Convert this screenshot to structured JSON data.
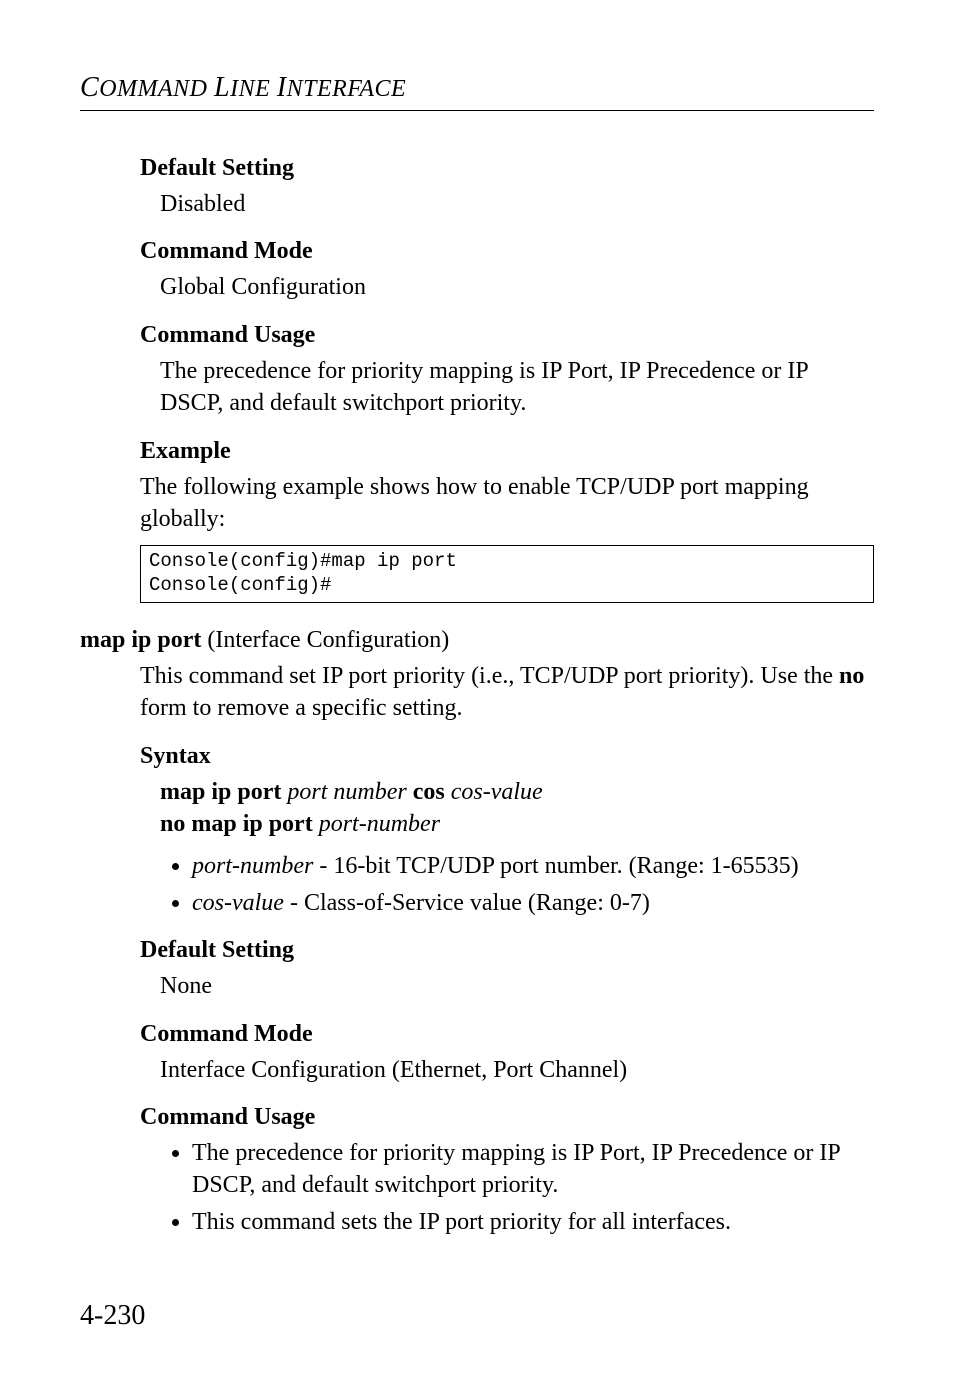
{
  "header": {
    "running_head_1": "C",
    "running_head_2": "OMMAND ",
    "running_head_3": "L",
    "running_head_4": "INE ",
    "running_head_5": "I",
    "running_head_6": "NTERFACE"
  },
  "sec1": {
    "default_h": "Default Setting",
    "default_v": "Disabled",
    "mode_h": "Command Mode",
    "mode_v": "Global Configuration",
    "usage_h": "Command Usage",
    "usage_v": "The precedence for priority mapping is IP Port, IP Precedence or IP DSCP, and default switchport priority.",
    "example_h": "Example",
    "example_intro": "The following example shows how to enable TCP/UDP port mapping globally:",
    "code": "Console(config)#map ip port\nConsole(config)#"
  },
  "cmd": {
    "title_bold": "map ip port",
    "title_rest": " (Interface Configuration)",
    "desc_p1": "This command set IP port priority (i.e., TCP/UDP port priority). Use the ",
    "desc_bold": "no",
    "desc_p2": " form to remove a specific setting.",
    "syntax_h": "Syntax",
    "syntax_l1_b1": "map ip port",
    "syntax_l1_i1": " port number ",
    "syntax_l1_b2": "cos",
    "syntax_l1_i2": " cos-value",
    "syntax_l2_b": "no map ip port",
    "syntax_l2_i": " port-number",
    "param1_i": "port-number",
    "param1_rest": " - 16-bit TCP/UDP port number. (Range: 1-65535)",
    "param2_i": "cos-value",
    "param2_rest": " - Class-of-Service value (Range: 0-7)",
    "default_h": "Default Setting",
    "default_v": "None",
    "mode_h": "Command Mode",
    "mode_v": "Interface Configuration (Ethernet, Port Channel)",
    "usage_h": "Command Usage",
    "usage_b1": "The precedence for priority mapping is IP Port, IP Precedence or IP DSCP, and default switchport priority.",
    "usage_b2": "This command sets the IP port priority for all interfaces."
  },
  "footer": {
    "page": "4-230"
  }
}
